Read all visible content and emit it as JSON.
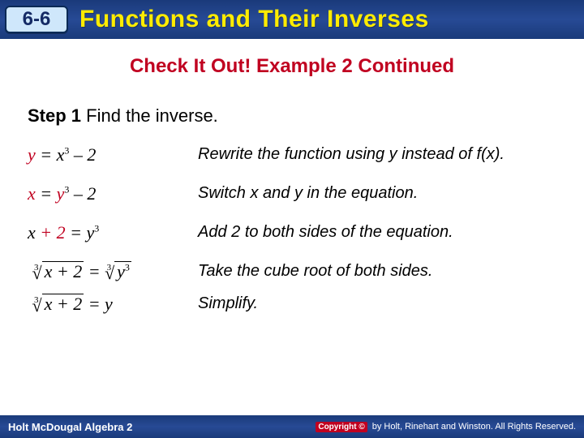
{
  "header": {
    "chapter": "6-6",
    "title": "Functions and Their Inverses"
  },
  "subtitle": "Check It Out! Example 2 Continued",
  "step": {
    "label": "Step 1",
    "text": "Find the inverse."
  },
  "rows": [
    {
      "eq_html": "<span class='blk'>y</span> = x<sup>3</sup> – 2",
      "expl": "Rewrite the function using y instead of f(x)."
    },
    {
      "eq_html": "<span class='blk'>x</span> = <span class='blk'>y</span><sup>3</sup> – 2",
      "expl": "Switch x and y in the equation."
    },
    {
      "eq_html": "x <span class='blk'>+ 2</span> = y<sup>3</sup>",
      "expl": "Add 2 to both sides of the equation."
    },
    {
      "eq_html": "<span class='rootidx'>3</span><span class='surd'>√</span><span class='radicand'>x + 2</span> =<span class='rootidx'>3</span><span class='surd'>√</span><span class='radicand'> y<sup>3</sup></span>",
      "expl": "Take the cube root of both sides."
    },
    {
      "eq_html": "<span class='rootidx'>3</span><span class='surd'>√</span><span class='radicand'>x + 2</span> = y",
      "expl": "Simplify."
    }
  ],
  "footer": {
    "left": "Holt McDougal Algebra 2",
    "copyright_badge": "Copyright ©",
    "copyright_text": "by Holt, Rinehart and Winston. All Rights Reserved."
  }
}
